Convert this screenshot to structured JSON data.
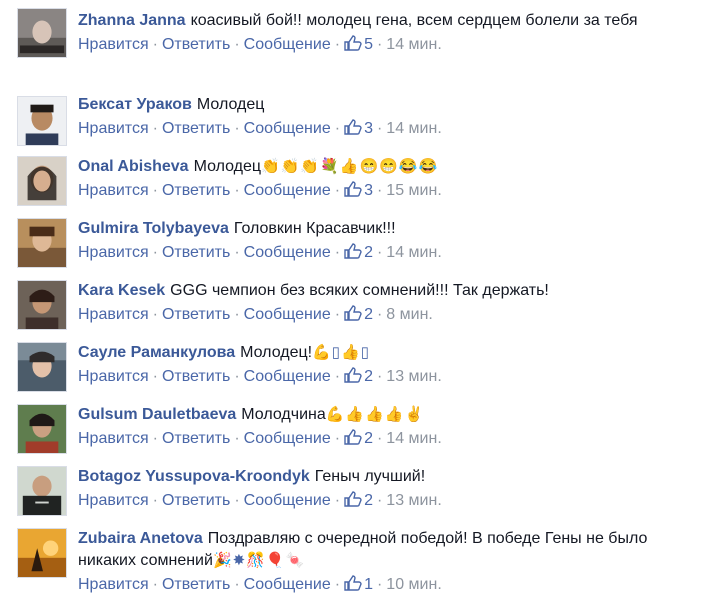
{
  "actions": {
    "like": "Нравится",
    "reply": "Ответить",
    "message": "Сообщение",
    "separator": "·"
  },
  "colors": {
    "name": "#3b5998",
    "link": "#4a67a8",
    "meta": "#8d949e",
    "text": "#141823"
  },
  "comments": [
    {
      "name": "Zhanna Janna",
      "text": "коасивый бой!! молодец гена, всем сердцем болели за тебя",
      "emoji": "",
      "likes": "5",
      "time": "14 мин."
    },
    {
      "name": "Бексат Ураков",
      "text": "Молодец",
      "emoji": "",
      "likes": "3",
      "time": "14 мин."
    },
    {
      "name": "Onal Abisheva",
      "text": "Молодец",
      "emoji": "👏👏👏💐👍😁😁😂😂",
      "likes": "3",
      "time": "15 мин."
    },
    {
      "name": "Gulmira Tolybayeva",
      "text": "Головкин Красавчик!!!",
      "emoji": "",
      "likes": "2",
      "time": "14 мин."
    },
    {
      "name": "Kara Kesek",
      "text": "GGG чемпион без всяких сомнений!!! Так держать!",
      "emoji": "",
      "likes": "2",
      "time": "8 мин."
    },
    {
      "name": "Сауле Раманкулова",
      "text": "Молодец!",
      "emoji": "💪▯👍▯",
      "likes": "2",
      "time": "13 мин."
    },
    {
      "name": "Gulsum Dauletbaeva",
      "text": "Молодчина",
      "emoji": "💪👍👍👍✌",
      "likes": "2",
      "time": "14 мин."
    },
    {
      "name": "Botagoz Yussupova-Kroondyk",
      "text": "Геныч лучший!",
      "emoji": "",
      "likes": "2",
      "time": "13 мин."
    },
    {
      "name": "Zubaira Anetova",
      "text": "Поздравляю с очередной победой! В победе Гены не было никаких сомнений",
      "emoji": "🎉✸🎊🎈🍬",
      "likes": "1",
      "time": "10 мин."
    }
  ]
}
